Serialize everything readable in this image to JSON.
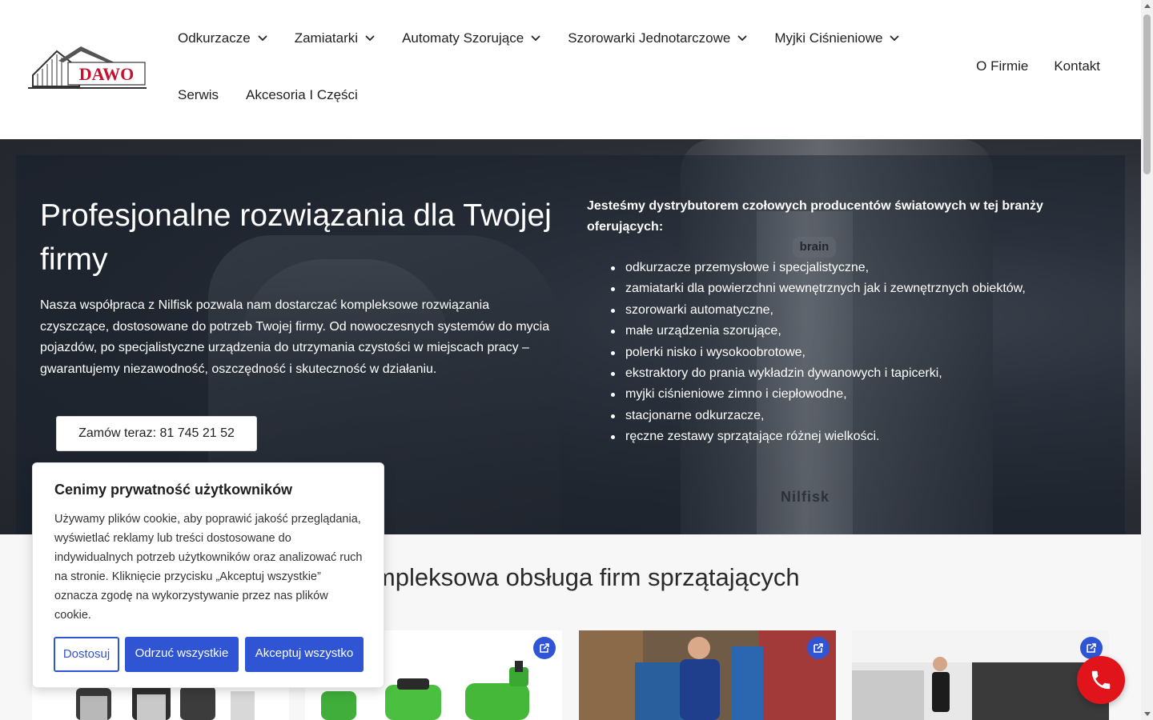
{
  "header": {
    "logo_text": "DAWO",
    "nav_primary": [
      {
        "label": "Odkurzacze",
        "has_dropdown": true
      },
      {
        "label": "Zamiatarki",
        "has_dropdown": true
      },
      {
        "label": "Automaty Szorujące",
        "has_dropdown": true
      },
      {
        "label": "Szorowarki Jednotarczowe",
        "has_dropdown": true
      },
      {
        "label": "Myjki Ciśnieniowe",
        "has_dropdown": true
      }
    ],
    "nav_secondary": [
      {
        "label": "Serwis"
      },
      {
        "label": "Akcesoria I Części"
      }
    ],
    "nav_right": [
      {
        "label": "O Firmie"
      },
      {
        "label": "Kontakt"
      }
    ]
  },
  "hero": {
    "title": "Profesjonalne rozwiązania dla Twojej firmy",
    "description": "Nasza współpraca z Nilfisk pozwala nam dostarczać kompleksowe rozwiązania czyszczące, dostosowane do potrzeb Twojej firmy. Od nowoczesnych systemów do mycia pojazdów, po specjalistyczne urządzenia do utrzymania czystości w miejscach pracy – gwarantujemy niezawodność, oszczędność i skuteczność w działaniu.",
    "order_button": "Zamów teraz: 81 745 21 52",
    "intro": "Jesteśmy dystrybutorem czołowych producentów światowych w tej branży oferujących:",
    "list": [
      "odkurzacze przemysłowe i specjalistyczne,",
      "zamiatarki dla powierzchni wewnętrznych jak i zewnętrznych obiektów,",
      "szorowarki automatyczne,",
      "małe urządzenia szorujące,",
      "polerki nisko i wysokoobrotowe,",
      "ekstraktory do prania wykładzin dywanowych i tapicerki,",
      "myjki ciśnieniowe zimno i ciepłowodne,",
      "stacjonarne odkurzacze,",
      "ręczne zestawy sprzątające różnej wielkości."
    ],
    "image_brand_text": "Nilfisk",
    "image_badge_text": "brain"
  },
  "section": {
    "title": "Kompleksowa obsługa firm sprzątających"
  },
  "cookie": {
    "title": "Cenimy prywatność użytkowników",
    "text": "Używamy plików cookie, aby poprawić jakość przeglądania, wyświetlać reklamy lub treści dostosowane do indywidualnych potrzeb użytkowników oraz analizować ruch na stronie. Kliknięcie przycisku „Akceptuj wszystkie” oznacza zgodę na wykorzystywanie przez nas plików cookie.",
    "customize": "Dostosuj",
    "reject": "Odrzuć wszystkie",
    "accept": "Akceptuj wszystko"
  },
  "colors": {
    "accent": "#2f55d4",
    "phone": "#e1141b",
    "logo_red": "#c8102e"
  }
}
